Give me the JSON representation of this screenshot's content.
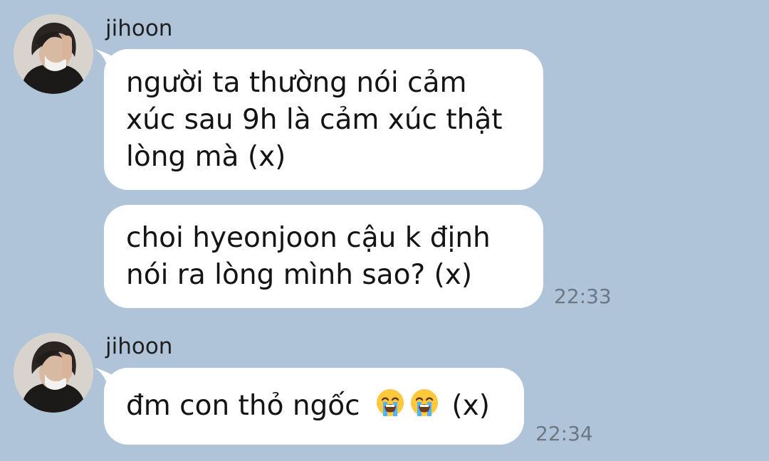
{
  "messages": [
    {
      "sender": "jihoon",
      "lines": [
        "người ta thường nói cảm",
        "xúc sau 9h là cảm xúc thật",
        "lòng mà (x)"
      ]
    },
    {
      "lines": [
        "choi hyeonjoon cậu k định",
        "nói ra lòng mình sao? (x)"
      ],
      "time": "22:33"
    },
    {
      "sender": "jihoon",
      "text_before": "đm con thỏ ngốc",
      "emojis": [
        "loudly-crying-face",
        "loudly-crying-face"
      ],
      "text_after": "(x)",
      "time": "22:34"
    }
  ],
  "colors": {
    "background": "#b0c4d9",
    "bubble": "#ffffff",
    "text": "#141414",
    "timestamp": "#6c7783"
  }
}
